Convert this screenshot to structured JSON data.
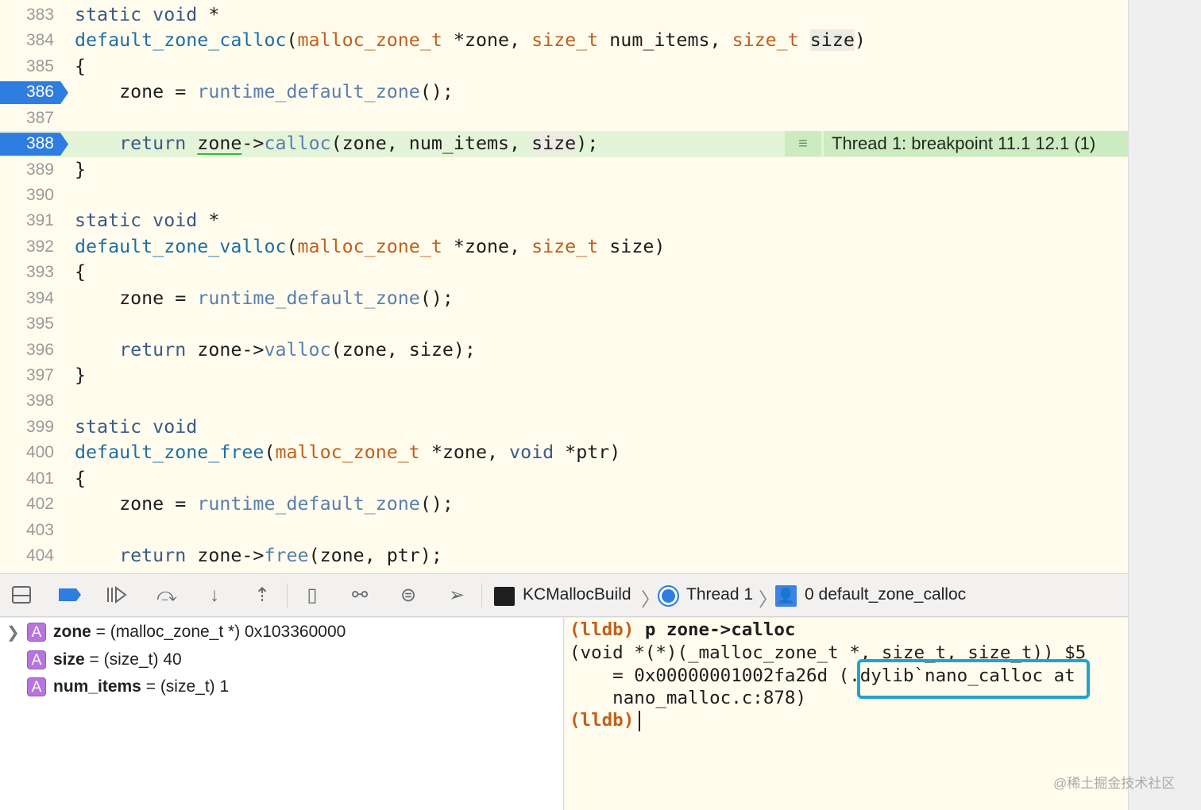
{
  "editor": {
    "lines": [
      {
        "n": "383",
        "t": [
          [
            "static void ",
            "kw"
          ],
          [
            "*",
            ""
          ]
        ]
      },
      {
        "n": "384",
        "t": [
          [
            "default_zone_calloc",
            "decl"
          ],
          [
            "(",
            ""
          ],
          [
            "malloc_zone_t",
            "type"
          ],
          [
            " *zone, ",
            ""
          ],
          [
            "size_t",
            "type"
          ],
          [
            " num_items, ",
            ""
          ],
          [
            "size_t",
            "type"
          ],
          [
            " ",
            ""
          ],
          [
            "size",
            "hl"
          ],
          [
            ")",
            ""
          ]
        ]
      },
      {
        "n": "385",
        "t": [
          [
            "{",
            ""
          ]
        ]
      },
      {
        "n": "386",
        "bp": true,
        "t": [
          [
            "    zone = ",
            ""
          ],
          [
            "runtime_default_zone",
            "call"
          ],
          [
            "();",
            ""
          ]
        ]
      },
      {
        "n": "387",
        "t": []
      },
      {
        "n": "388",
        "bp": true,
        "current": true,
        "t": [
          [
            "    ",
            ""
          ],
          [
            "return",
            "kw"
          ],
          [
            " ",
            ""
          ],
          [
            "zone",
            "ul"
          ],
          [
            "->",
            ""
          ],
          [
            "calloc",
            "call"
          ],
          [
            "(zone, num_items, ",
            ""
          ],
          [
            "size",
            "hl"
          ],
          [
            ");",
            ""
          ]
        ]
      },
      {
        "n": "389",
        "t": [
          [
            "}",
            ""
          ]
        ]
      },
      {
        "n": "390",
        "t": []
      },
      {
        "n": "391",
        "t": [
          [
            "static void ",
            "kw"
          ],
          [
            "*",
            ""
          ]
        ]
      },
      {
        "n": "392",
        "t": [
          [
            "default_zone_valloc",
            "decl"
          ],
          [
            "(",
            ""
          ],
          [
            "malloc_zone_t",
            "type"
          ],
          [
            " *zone, ",
            ""
          ],
          [
            "size_t",
            "type"
          ],
          [
            " size)",
            ""
          ]
        ]
      },
      {
        "n": "393",
        "t": [
          [
            "{",
            ""
          ]
        ]
      },
      {
        "n": "394",
        "t": [
          [
            "    zone = ",
            ""
          ],
          [
            "runtime_default_zone",
            "call"
          ],
          [
            "();",
            ""
          ]
        ]
      },
      {
        "n": "395",
        "t": []
      },
      {
        "n": "396",
        "t": [
          [
            "    ",
            ""
          ],
          [
            "return",
            "kw"
          ],
          [
            " zone->",
            ""
          ],
          [
            "valloc",
            "call"
          ],
          [
            "(zone, size);",
            ""
          ]
        ]
      },
      {
        "n": "397",
        "t": [
          [
            "}",
            ""
          ]
        ]
      },
      {
        "n": "398",
        "t": []
      },
      {
        "n": "399",
        "t": [
          [
            "static void",
            "kw"
          ]
        ]
      },
      {
        "n": "400",
        "t": [
          [
            "default_zone_free",
            "decl"
          ],
          [
            "(",
            ""
          ],
          [
            "malloc_zone_t",
            "type"
          ],
          [
            " *zone, ",
            ""
          ],
          [
            "void",
            "kw"
          ],
          [
            " *ptr)",
            ""
          ]
        ]
      },
      {
        "n": "401",
        "t": [
          [
            "{",
            ""
          ]
        ]
      },
      {
        "n": "402",
        "t": [
          [
            "    zone = ",
            ""
          ],
          [
            "runtime_default_zone",
            "call"
          ],
          [
            "();",
            ""
          ]
        ]
      },
      {
        "n": "403",
        "t": []
      },
      {
        "n": "404",
        "t": [
          [
            "    ",
            ""
          ],
          [
            "return",
            "kw"
          ],
          [
            " zone->",
            ""
          ],
          [
            "free",
            "call"
          ],
          [
            "(zone, ptr);",
            ""
          ]
        ]
      }
    ],
    "annotation": {
      "icon": "lines-icon",
      "label": "Thread 1: breakpoint 11.1 12.1 (1)"
    }
  },
  "toolbar": {
    "breadcrumbs": {
      "target": "KCMallocBuild",
      "thread": "Thread 1",
      "frame": "0 default_zone_calloc"
    }
  },
  "variables": [
    {
      "name": "zone",
      "eq": " = ",
      "type": "(malloc_zone_t *)",
      "value": " 0x103360000",
      "expandable": true
    },
    {
      "name": "size",
      "eq": " = ",
      "type": "(size_t)",
      "value": " 40"
    },
    {
      "name": "num_items",
      "eq": " = ",
      "type": "(size_t)",
      "value": " 1"
    }
  ],
  "console": {
    "prompt": "(lldb)",
    "command": " p zone->calloc",
    "out1": "(void *(*)(_malloc_zone_t *, size_t, size_t)) $5",
    "out2": "    = 0x00000001002fa26d (.dylib`nano_calloc at",
    "out3": "    nano_malloc.c:878)"
  },
  "watermark": "@稀土掘金技术社区",
  "colors": {
    "breakpoint": "#2f7de1",
    "current_line": "#e4f4d8",
    "highlight_box": "#22a2d0"
  }
}
